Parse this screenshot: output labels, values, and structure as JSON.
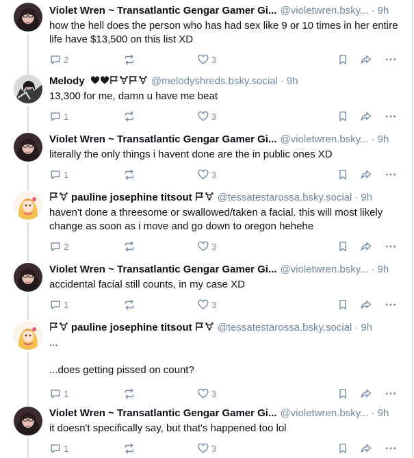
{
  "colors": {
    "text": "#0b0f14",
    "muted": "#6f869f",
    "icon": "#788ea5",
    "line": "#d4dbe2"
  },
  "posts": [
    {
      "name": "Violet Wren ~ Transatlantic Gengar Gamer Gi...",
      "handle": "@violetwren.bsky...",
      "time": "9h",
      "text": "how the hell does the person who has had sex like 9 or 10 times in her entire life have $13,500 on this list XD",
      "replies": "2",
      "reposts": "",
      "likes": "3",
      "avatar": "violet-avatar"
    },
    {
      "name": "Melody",
      "name_icons": [
        "black-heart-icon",
        "black-heart-icon",
        "white-flag-icon",
        "transgender-symbol-icon",
        "white-flag-icon",
        "transgender-symbol-icon"
      ],
      "handle": "@melodyshreds.bsky.social",
      "time": "9h",
      "text": "13,300 for me, damn u have me beat",
      "replies": "1",
      "reposts": "",
      "likes": "3",
      "avatar": "melody-avatar"
    },
    {
      "name": "Violet Wren ~ Transatlantic Gengar Gamer Gi...",
      "handle": "@violetwren.bsky...",
      "time": "9h",
      "text": "literally the only things i havent done are the in public ones XD",
      "replies": "1",
      "reposts": "",
      "likes": "3",
      "avatar": "violet-avatar"
    },
    {
      "name": "pauline josephine titsout",
      "handle": "@tessatestarossa.bsky.social",
      "time": "9h",
      "text": "haven't done a threesome or swallowed/taken a facial. this will most likely change as soon as i move and go down to oregon hehehe",
      "replies": "2",
      "reposts": "",
      "likes": "3",
      "avatar": "pauline-avatar"
    },
    {
      "name": "Violet Wren ~ Transatlantic Gengar Gamer Gi...",
      "handle": "@violetwren.bsky...",
      "time": "9h",
      "text": "accidental facial still counts, in my case XD",
      "replies": "1",
      "reposts": "",
      "likes": "3",
      "avatar": "violet-avatar"
    },
    {
      "name": "pauline josephine titsout",
      "handle": "@tessatestarossa.bsky.social",
      "time": "9h",
      "text": "...\n\n...does getting pissed on count?",
      "replies": "1",
      "reposts": "",
      "likes": "3",
      "avatar": "pauline-avatar"
    },
    {
      "name": "Violet Wren ~ Transatlantic Gengar Gamer Gi...",
      "handle": "@violetwren.bsky...",
      "time": "9h",
      "text": "it doesn't specifically say, but that's happened too lol",
      "replies": "1",
      "reposts": "",
      "likes": "3",
      "avatar": "violet-avatar"
    }
  ]
}
